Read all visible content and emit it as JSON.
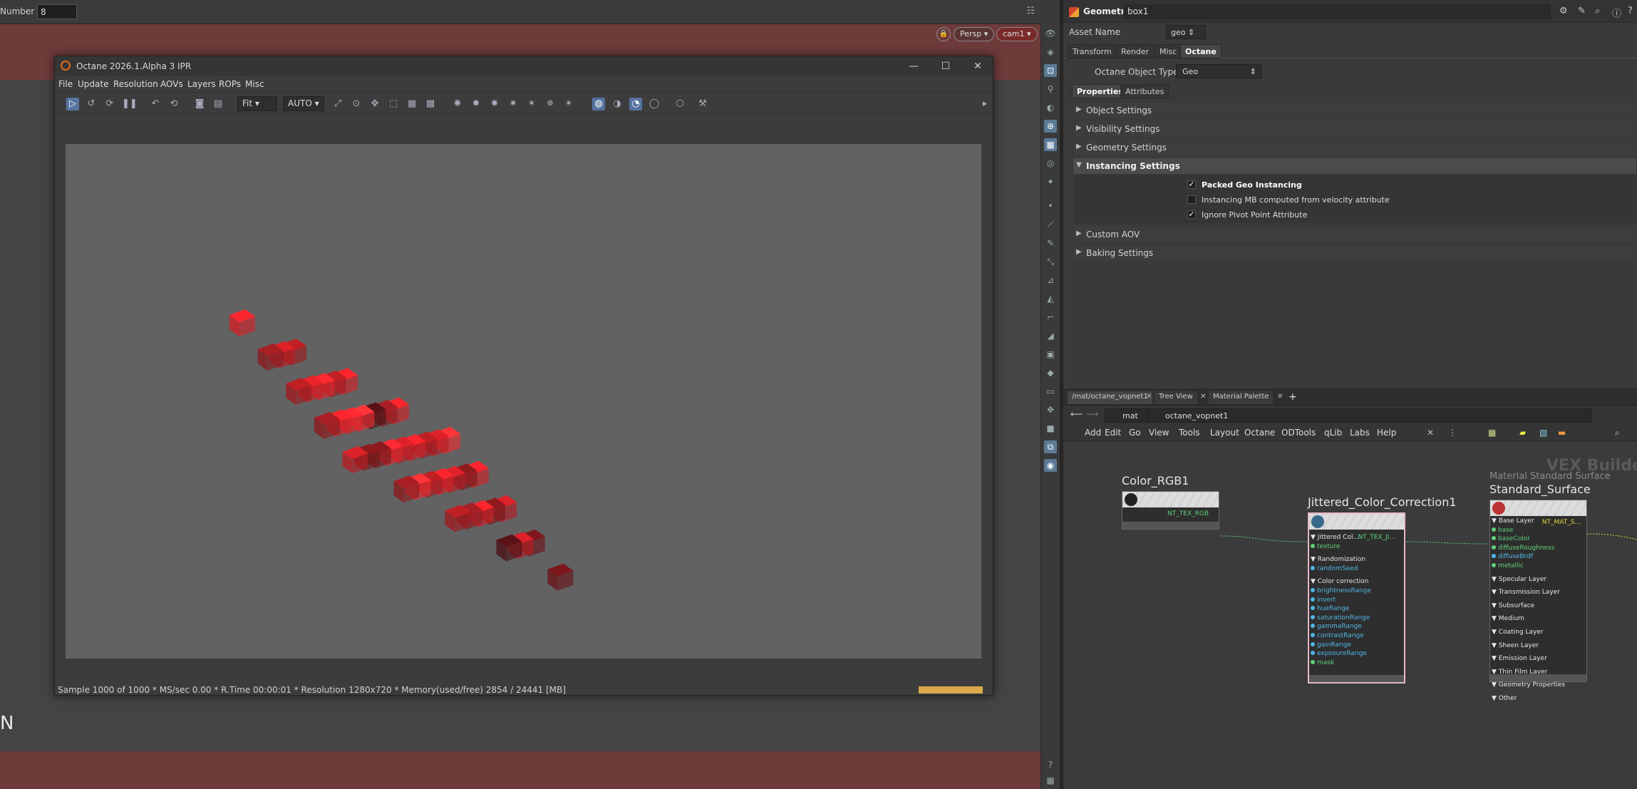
{
  "viewport": {
    "frame_label": "Number",
    "frame_value": "8",
    "persp_label": "Persp",
    "cam_label": "cam1",
    "safe_letter": "N",
    "colors": {
      "safe_area": "#6e3a3a",
      "background": "#444444"
    }
  },
  "ipr": {
    "title": "Octane 2026.1.Alpha 3 IPR",
    "menu": [
      "File",
      "Update",
      "Resolution",
      "AOVs",
      "Layers",
      "ROPs",
      "Misc"
    ],
    "fit_label": "Fit",
    "auto_label": "AUTO",
    "status": "Sample 1000 of 1000 * MS/sec 0.00 * R.Time 00:00:01 * Resolution 1280x720 * Memory(used/free) 2854 / 24441 [MB]",
    "progress_fraction": 1.0,
    "colors": {
      "render_bg": "#626262",
      "cube_red": "#e0242a",
      "accent": "#e86a1b"
    }
  },
  "param": {
    "node_type": "Geometry",
    "node_name": "box1",
    "asset_label": "Asset Name",
    "asset_value": "geo",
    "tabs": [
      "Transform",
      "Render",
      "Misc",
      "Octane"
    ],
    "active_tab": "Octane",
    "object_type_label": "Octane Object Type",
    "object_type_value": "Geo",
    "subtabs": [
      "Properties",
      "Attributes"
    ],
    "sections": {
      "object": "Object Settings",
      "visibility": "Visibility Settings",
      "geometry": "Geometry Settings",
      "instancing": "Instancing Settings",
      "custom_aov": "Custom AOV",
      "baking": "Baking Settings"
    },
    "instancing_options": [
      {
        "label": "Packed Geo Instancing",
        "checked": true
      },
      {
        "label": "Instancing MB computed from velocity attribute",
        "checked": false
      },
      {
        "label": "Ignore Pivot Point Attribute",
        "checked": true
      }
    ]
  },
  "network": {
    "tabs": [
      "/mat/octane_vopnet1",
      "Tree View",
      "Material Palette"
    ],
    "path_mat": "mat",
    "path_vop": "octane_vopnet1",
    "menu": [
      "Add",
      "Edit",
      "Go",
      "View",
      "Tools",
      "Layout",
      "Octane",
      "ODTools",
      "qLib",
      "Labs",
      "Help"
    ],
    "watermark": "VEX Builder",
    "nodes": {
      "color_rgb": {
        "title": "Color_RGB1",
        "output": "NT_TEX_RGB"
      },
      "jittered": {
        "title": "Jittered_Color_Correction1",
        "output": "NT_TEX_JI...",
        "ports": [
          {
            "label": "Jittered Col...",
            "kind": "grp"
          },
          {
            "label": "texture",
            "kind": "g"
          },
          {
            "label": "Randomization",
            "kind": "grp"
          },
          {
            "label": "randomSeed",
            "kind": "b"
          },
          {
            "label": "Color correction",
            "kind": "grp"
          },
          {
            "label": "brightnessRange",
            "kind": "b"
          },
          {
            "label": "invert",
            "kind": "b"
          },
          {
            "label": "hueRange",
            "kind": "b"
          },
          {
            "label": "saturationRange",
            "kind": "b"
          },
          {
            "label": "gammaRange",
            "kind": "b"
          },
          {
            "label": "contrastRange",
            "kind": "b"
          },
          {
            "label": "gainRange",
            "kind": "b"
          },
          {
            "label": "exposureRange",
            "kind": "b"
          },
          {
            "label": "mask",
            "kind": "g"
          }
        ]
      },
      "standard": {
        "subtitle": "Material Standard Surface",
        "title": "Standard_Surface",
        "output": "NT_MAT_S...",
        "ports": [
          {
            "label": "Base Layer",
            "kind": "grp"
          },
          {
            "label": "base",
            "kind": "g"
          },
          {
            "label": "baseColor",
            "kind": "g"
          },
          {
            "label": "diffuseRoughness",
            "kind": "g"
          },
          {
            "label": "diffuseBrdf",
            "kind": "b"
          },
          {
            "label": "metallic",
            "kind": "g"
          },
          {
            "label": "Specular Layer",
            "kind": "grp"
          },
          {
            "label": "Transmission Layer",
            "kind": "grp"
          },
          {
            "label": "Subsurface",
            "kind": "grp"
          },
          {
            "label": "Medium",
            "kind": "grp"
          },
          {
            "label": "Coating Layer",
            "kind": "grp"
          },
          {
            "label": "Sheen Layer",
            "kind": "grp"
          },
          {
            "label": "Emission Layer",
            "kind": "grp"
          },
          {
            "label": "Thin Film Layer",
            "kind": "grp"
          },
          {
            "label": "Geometry Properties",
            "kind": "grp"
          },
          {
            "label": "Other",
            "kind": "grp"
          }
        ]
      }
    }
  }
}
